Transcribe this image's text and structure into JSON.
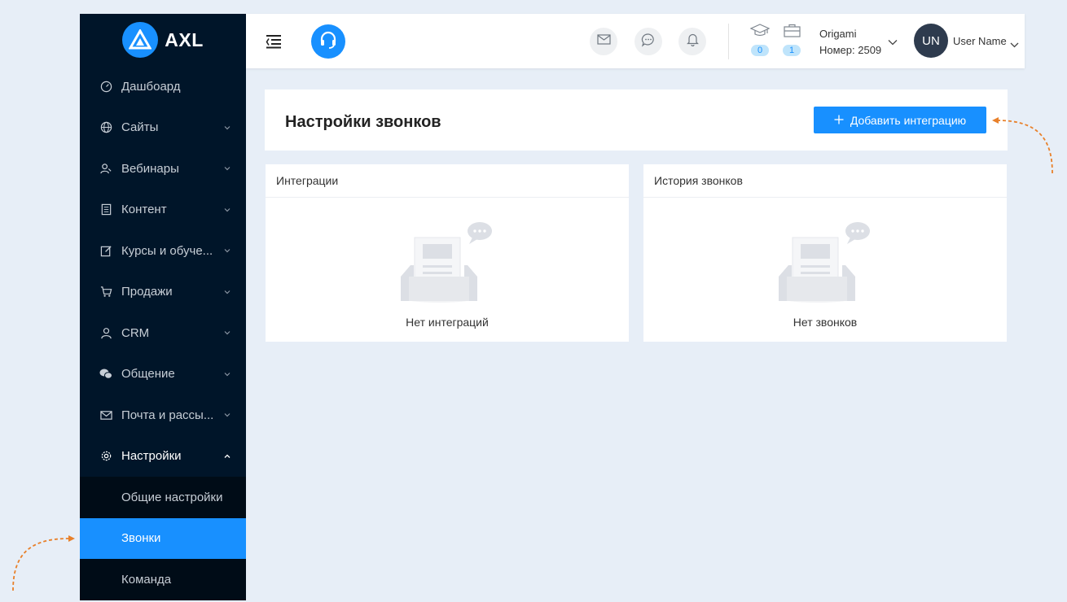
{
  "brand": {
    "name": "AXL",
    "accent": "#1890ff",
    "sidebar_bg": "#001529"
  },
  "sidebar": {
    "items": [
      {
        "label": "Дашбоард",
        "icon": "dashboard-icon"
      },
      {
        "label": "Сайты",
        "icon": "globe-icon"
      },
      {
        "label": "Вебинары",
        "icon": "users-icon"
      },
      {
        "label": "Контент",
        "icon": "document-icon"
      },
      {
        "label": "Курсы и обуче...",
        "icon": "edit-icon"
      },
      {
        "label": "Продажи",
        "icon": "cart-icon"
      },
      {
        "label": "CRM",
        "icon": "user-icon"
      },
      {
        "label": "Общение",
        "icon": "chat-icon"
      },
      {
        "label": "Почта и рассы...",
        "icon": "mail-icon"
      },
      {
        "label": "Настройки",
        "icon": "gear-icon"
      }
    ],
    "submenu": [
      {
        "label": "Общие настройки"
      },
      {
        "label": "Звонки"
      },
      {
        "label": "Команда"
      }
    ]
  },
  "header": {
    "counters": {
      "courses": "0",
      "orders": "1"
    },
    "company": {
      "name": "Origami",
      "number": "Номер: 2509"
    },
    "user": {
      "initials": "UN",
      "name": "User Name"
    }
  },
  "page": {
    "title": "Настройки звонков",
    "add_button": "Добавить интеграцию"
  },
  "panels": [
    {
      "title": "Интеграции",
      "empty_text": "Нет интеграций"
    },
    {
      "title": "История звонков",
      "empty_text": "Нет звонков"
    }
  ]
}
